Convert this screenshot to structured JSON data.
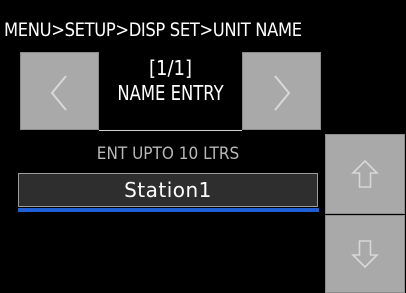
{
  "header": {
    "breadcrumb": "MENU>SETUP>DISP SET>UNIT NAME"
  },
  "pager": {
    "page_indicator": "[1/1]",
    "title": "NAME ENTRY",
    "prev_icon": "chevron-left-icon",
    "next_icon": "chevron-right-icon"
  },
  "entry": {
    "hint": "ENT UPTO 10 LTRS",
    "value": "Station1"
  },
  "scroll": {
    "up_icon": "arrow-up-icon",
    "down_icon": "arrow-down-icon"
  },
  "colors": {
    "background": "#000000",
    "button_gray": "#a9a9a9",
    "icon_light": "#d8d8d8",
    "input_bg": "#2e2e2e",
    "accent_blue": "#1f5fd6",
    "hint_gray": "#b8b8b8"
  }
}
